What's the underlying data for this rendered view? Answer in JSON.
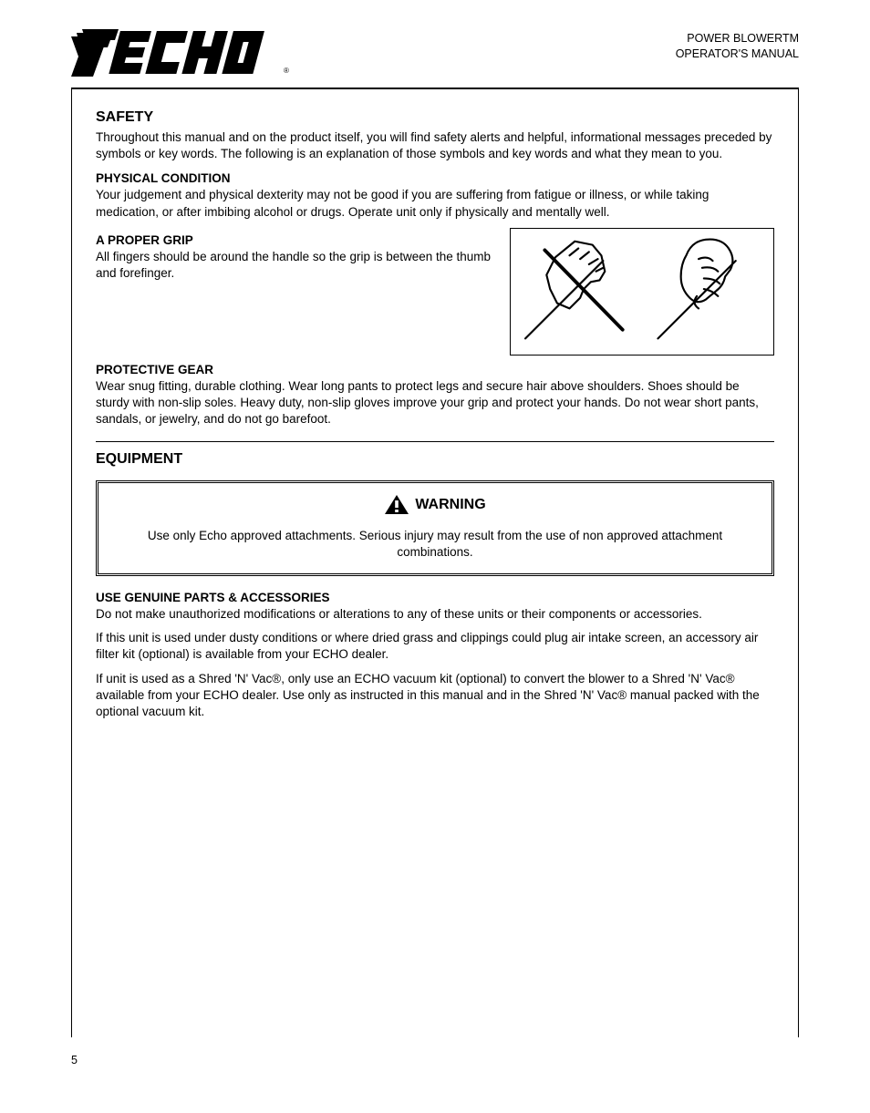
{
  "header": {
    "logo_alt": "ECHO",
    "product_lines": [
      "POWER BLOWERTM",
      "OPERATOR'S MANUAL"
    ]
  },
  "section_safety": {
    "title": "safety",
    "intro": "Throughout this manual and on the product itself, you will find safety alerts and helpful, informational messages preceded by symbols or key words. The following is an explanation of those symbols and key words and what they mean to you.",
    "pc_heading": "PHYSICAL CONDITION",
    "pc_text": "Your judgement and physical dexterity may not be good if you are suffering from fatigue or illness, or while taking medication, or after imbibing alcohol or drugs. Operate unit only if physically and mentally well.",
    "grip_heading": "A PROPER GRIP",
    "grip_text": "All fingers should be around the handle so the grip is between the thumb and forefinger.",
    "gear_heading": "PROTECTIVE GEAR",
    "gear_text": "Wear snug fitting, durable clothing. Wear long pants to protect legs and secure hair above shoulders. Shoes should be sturdy with non-slip soles. Heavy duty, non-slip gloves improve your grip and protect your hands. Do not wear short pants, sandals, or jewelry, and do not go barefoot."
  },
  "illustration": {
    "name": "grip-illustration",
    "caption": ""
  },
  "section_equipment": {
    "title": "equipment",
    "warning": {
      "label": "WARNING",
      "text": "Use only Echo approved attachments. Serious injury may result from the use of non approved attachment combinations."
    },
    "h3": "USE GENUINE PARTS & ACCESSORIES",
    "items": [
      "Do not make unauthorized modifications or alterations to any of these units or their components or accessories.",
      "If this unit is used under dusty conditions or where dried grass and clippings could plug air intake screen, an accessory air filter kit (optional) is available from your ECHO dealer.",
      "If unit is used as a Shred 'N' Vac®, only use an ECHO vacuum kit (optional) to convert the blower to a Shred 'N' Vac® available from your ECHO dealer. Use only as instructed in this manual and in the Shred 'N' Vac® manual packed with the optional vacuum kit."
    ]
  },
  "footer": {
    "page": "5"
  }
}
